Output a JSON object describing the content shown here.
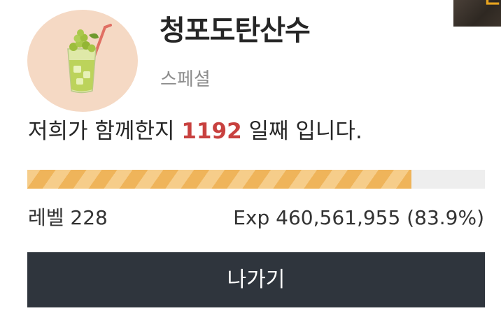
{
  "corner_thumbnail": {
    "glyph_fragment": "ㄹ"
  },
  "profile": {
    "avatar": "green-drink-icon",
    "name": "청포도탄산수",
    "grade": "스페셜"
  },
  "days": {
    "prefix": "저희가 함께한지 ",
    "count": "1192",
    "suffix": " 일째 입니다."
  },
  "experience": {
    "progress_percent": 83.9,
    "level_label": "레벨 228",
    "exp_label": "Exp 460,561,955 (83.9%)"
  },
  "exit_button": {
    "label": "나가기"
  },
  "colors": {
    "accent_red": "#c8413f",
    "bar_fill": "#efb45a",
    "button_bg": "#2f353d",
    "avatar_bg": "#f5d9c4"
  }
}
